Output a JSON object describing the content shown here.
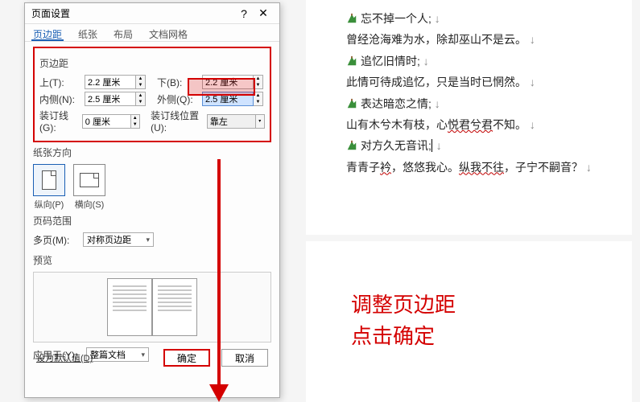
{
  "dialog": {
    "title": "页面设置",
    "tabs": [
      "页边距",
      "纸张",
      "布局",
      "文档网格"
    ],
    "active_tab": 0,
    "section_margins": "页边距",
    "labels": {
      "top": "上(T):",
      "bottom": "下(B):",
      "inner": "内侧(N):",
      "outer": "外侧(Q):",
      "gutter": "装订线(G):",
      "gutter_pos": "装订线位置(U):"
    },
    "values": {
      "top": "2.2 厘米",
      "bottom": "2.2 厘米",
      "inner": "2.5 厘米",
      "outer": "2.5 厘米",
      "gutter": "0 厘米",
      "gutter_pos": "靠左"
    },
    "section_orientation": "纸张方向",
    "orientation": {
      "portrait": "纵向(P)",
      "landscape": "横向(S)"
    },
    "section_pages": "页码范围",
    "multi_label": "多页(M):",
    "multi_value": "对称页边距",
    "section_preview": "预览",
    "apply_label": "应用于(Y):",
    "apply_value": "整篇文档",
    "set_default": "设为默认值(D)",
    "ok": "确定",
    "cancel": "取消"
  },
  "doc": {
    "lines": [
      {
        "bullet": true,
        "text": "忘不掉一个人;"
      },
      {
        "text_parts": [
          "曾经沧海难为水，除却巫山不是云。"
        ]
      },
      {
        "bullet": true,
        "text": "追忆旧情时;"
      },
      {
        "text_parts": [
          "此情可待成追忆，只是当时已惘然。"
        ]
      },
      {
        "bullet": true,
        "text": "表达暗恋之情;"
      },
      {
        "text_parts": [
          "山有木兮木有枝，心",
          "悦君兮君",
          "不知。"
        ],
        "u_idx": 1
      },
      {
        "bullet": true,
        "text": "对方久无音讯;",
        "cursor": true
      },
      {
        "text_parts": [
          "青青子",
          "衿",
          "，悠悠我心。",
          "纵我不往",
          "，子宁不嗣音？"
        ],
        "u_idx": 3,
        "u2_idx": 1
      }
    ]
  },
  "annotation": {
    "line1": "调整页边距",
    "line2": "点击确定"
  },
  "colors": {
    "accent_red": "#d40000"
  }
}
